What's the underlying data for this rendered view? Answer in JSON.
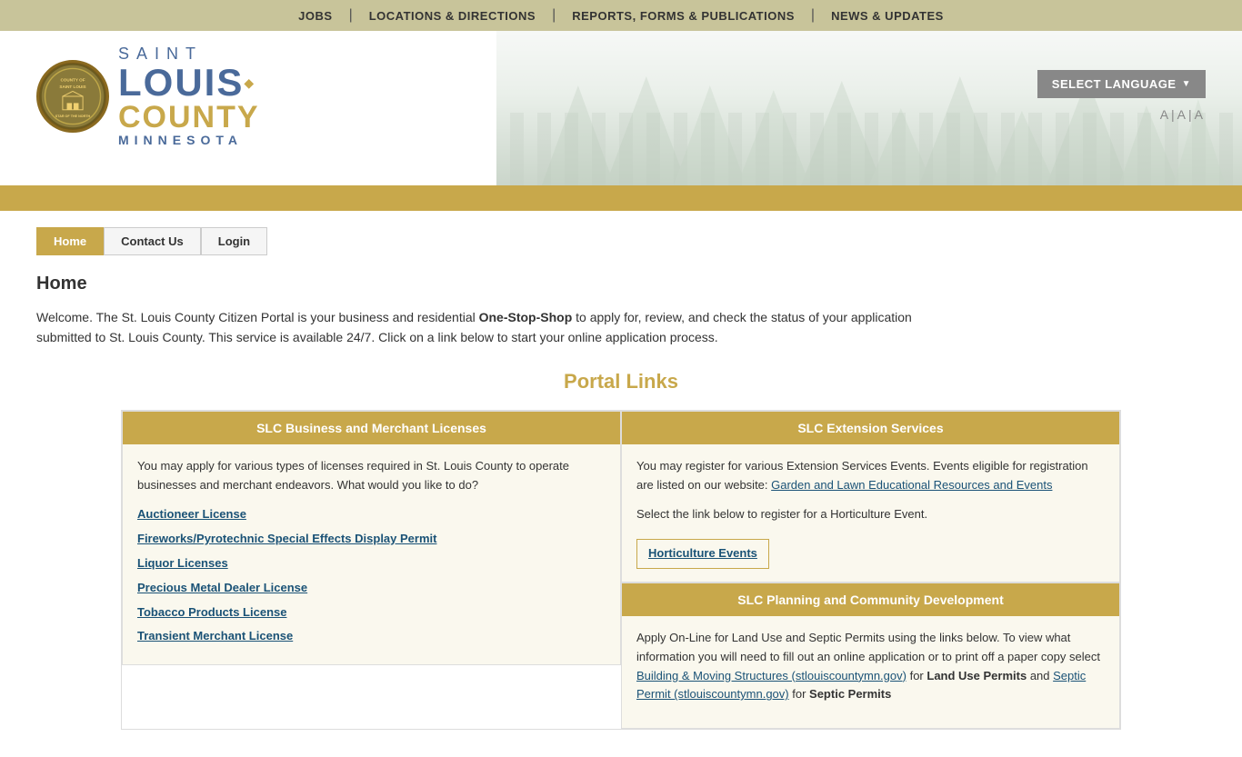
{
  "topbar": {
    "links": [
      {
        "label": "JOBS",
        "id": "jobs"
      },
      {
        "label": "LOCATIONS & DIRECTIONS",
        "id": "locations"
      },
      {
        "label": "REPORTS, FORMS & PUBLICATIONS",
        "id": "reports"
      },
      {
        "label": "NEWS & UPDATES",
        "id": "news"
      }
    ]
  },
  "header": {
    "seal_text": "COUNTY\nOF\nSAINT LOUIS",
    "logo_saint": "SAINT",
    "logo_louis": "LOUIS",
    "logo_county": "COUNTY",
    "logo_minnesota": "MINNESOTA",
    "language_button": "SELECT LANGUAGE",
    "font_controls": "A|A|A"
  },
  "nav": {
    "tabs": [
      {
        "label": "Home",
        "id": "home",
        "active": true
      },
      {
        "label": "Contact Us",
        "id": "contact",
        "active": false
      },
      {
        "label": "Login",
        "id": "login",
        "active": false
      }
    ]
  },
  "main": {
    "page_title": "Home",
    "intro": "Welcome. The St. Louis County Citizen Portal is your business and residential ",
    "intro_bold": "One-Stop-Shop",
    "intro_end": " to apply for, review, and check the status of your application submitted to St. Louis County. This service is available 24/7. Click on a link below to start your online application process.",
    "portal_links_title": "Portal Links",
    "cards": [
      {
        "id": "business",
        "header": "SLC Business and Merchant Licenses",
        "body_text": "You may apply for various types of licenses required in St. Louis County to operate businesses and merchant endeavors. What would you like to do?",
        "links": [
          {
            "label": "Auctioneer License",
            "id": "auctioneer"
          },
          {
            "label": "Fireworks/Pyrotechnic Special Effects Display Permit",
            "id": "fireworks"
          },
          {
            "label": "Liquor Licenses",
            "id": "liquor"
          },
          {
            "label": "Precious Metal Dealer License",
            "id": "precious-metal"
          },
          {
            "label": "Tobacco Products License",
            "id": "tobacco"
          },
          {
            "label": "Transient Merchant License",
            "id": "transient"
          }
        ]
      },
      {
        "id": "extension",
        "header": "SLC Extension Services",
        "body_text": "You may register for various Extension Services Events. Events eligible for registration are listed on our website: ",
        "body_link": "Garden and Lawn Educational Resources and Events",
        "body_text2": "Select the link below to register for a Horticulture Event.",
        "horticulture_btn": "Horticulture Events"
      }
    ],
    "planning_card": {
      "header": "SLC Planning and Community Development",
      "body_text1": "Apply On-Line for Land Use and Septic Permits using the links below. To view what information you will need to fill out an online application or to print off a paper copy select ",
      "body_link1": "Building & Moving Structures (stlouiscountymn.gov)",
      "body_text2": " for ",
      "body_bold2": "Land Use Permits",
      "body_text3": " and ",
      "body_link2": "Septic Permit (stlouiscountymn.gov)",
      "body_text4": " for ",
      "body_bold4": "Septic Permits"
    }
  }
}
